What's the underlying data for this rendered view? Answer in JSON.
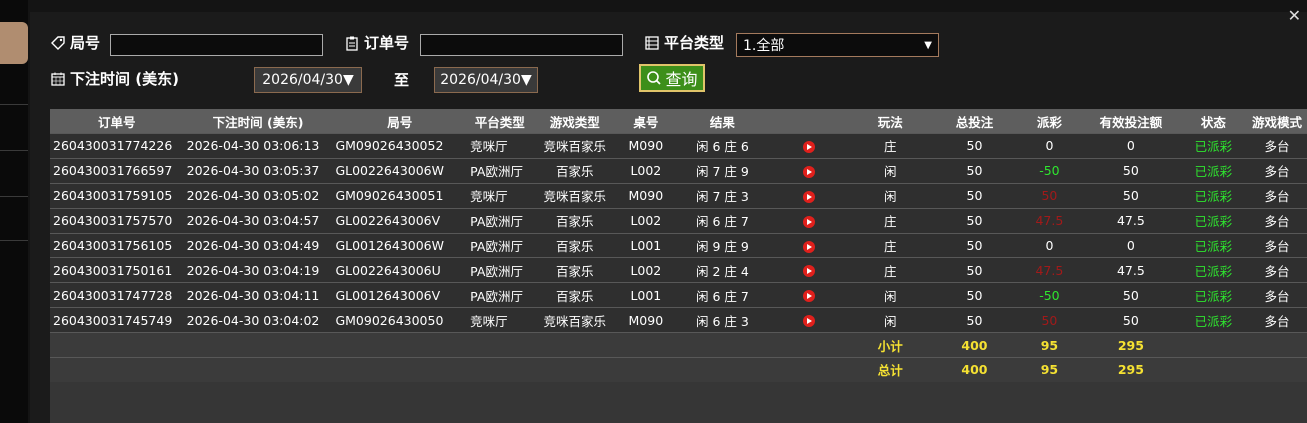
{
  "filters": {
    "round_label": "局号",
    "round_value": "",
    "order_label": "订单号",
    "order_value": "",
    "platform_label": "平台类型",
    "platform_selected": "1.全部",
    "bet_time_label": "下注时间 (美东)",
    "date_from": "2026/04/30▼",
    "to_label": "至",
    "date_to": "2026/04/30▼",
    "query_button": "查询"
  },
  "table": {
    "headers": [
      "订单号",
      "下注时间 (美东)",
      "局号",
      "平台类型",
      "游戏类型",
      "桌号",
      "结果",
      "",
      "玩法",
      "总投注",
      "派彩",
      "有效投注额",
      "状态",
      "游戏模式"
    ],
    "rows": [
      {
        "order": "260430031774226",
        "time": "2026-04-30 03:06:13",
        "round": "GM09026430052",
        "platform": "竞咪厅",
        "game": "竞咪百家乐",
        "table": "M090",
        "result": "闲 6 庄 6",
        "play": "庄",
        "bet": "50",
        "payout": "0",
        "payout_color": "white",
        "valid": "0",
        "status": "已派彩",
        "mode": "多台"
      },
      {
        "order": "260430031766597",
        "time": "2026-04-30 03:05:37",
        "round": "GL0022643006W",
        "platform": "PA欧洲厅",
        "game": "百家乐",
        "table": "L002",
        "result": "闲 7 庄 9",
        "play": "闲",
        "bet": "50",
        "payout": "-50",
        "payout_color": "green",
        "valid": "50",
        "status": "已派彩",
        "mode": "多台"
      },
      {
        "order": "260430031759105",
        "time": "2026-04-30 03:05:02",
        "round": "GM09026430051",
        "platform": "竞咪厅",
        "game": "竞咪百家乐",
        "table": "M090",
        "result": "闲 7 庄 3",
        "play": "闲",
        "bet": "50",
        "payout": "50",
        "payout_color": "red",
        "valid": "50",
        "status": "已派彩",
        "mode": "多台"
      },
      {
        "order": "260430031757570",
        "time": "2026-04-30 03:04:57",
        "round": "GL0022643006V",
        "platform": "PA欧洲厅",
        "game": "百家乐",
        "table": "L002",
        "result": "闲 6 庄 7",
        "play": "庄",
        "bet": "50",
        "payout": "47.5",
        "payout_color": "red",
        "valid": "47.5",
        "status": "已派彩",
        "mode": "多台"
      },
      {
        "order": "260430031756105",
        "time": "2026-04-30 03:04:49",
        "round": "GL0012643006W",
        "platform": "PA欧洲厅",
        "game": "百家乐",
        "table": "L001",
        "result": "闲 9 庄 9",
        "play": "庄",
        "bet": "50",
        "payout": "0",
        "payout_color": "white",
        "valid": "0",
        "status": "已派彩",
        "mode": "多台"
      },
      {
        "order": "260430031750161",
        "time": "2026-04-30 03:04:19",
        "round": "GL0022643006U",
        "platform": "PA欧洲厅",
        "game": "百家乐",
        "table": "L002",
        "result": "闲 2 庄 4",
        "play": "庄",
        "bet": "50",
        "payout": "47.5",
        "payout_color": "red",
        "valid": "47.5",
        "status": "已派彩",
        "mode": "多台"
      },
      {
        "order": "260430031747728",
        "time": "2026-04-30 03:04:11",
        "round": "GL0012643006V",
        "platform": "PA欧洲厅",
        "game": "百家乐",
        "table": "L001",
        "result": "闲 6 庄 7",
        "play": "闲",
        "bet": "50",
        "payout": "-50",
        "payout_color": "green",
        "valid": "50",
        "status": "已派彩",
        "mode": "多台"
      },
      {
        "order": "260430031745749",
        "time": "2026-04-30 03:04:02",
        "round": "GM09026430050",
        "platform": "竞咪厅",
        "game": "竞咪百家乐",
        "table": "M090",
        "result": "闲 6 庄 3",
        "play": "闲",
        "bet": "50",
        "payout": "50",
        "payout_color": "red",
        "valid": "50",
        "status": "已派彩",
        "mode": "多台"
      }
    ],
    "subtotal": {
      "label": "小计",
      "bet": "400",
      "payout": "95",
      "valid": "295"
    },
    "total": {
      "label": "总计",
      "bet": "400",
      "payout": "95",
      "valid": "295"
    }
  },
  "colors": {
    "status_green": "#2ee52e",
    "win_red": "#a11a1a",
    "total_yellow": "#f5e132",
    "query_green": "#3d8f1a"
  }
}
